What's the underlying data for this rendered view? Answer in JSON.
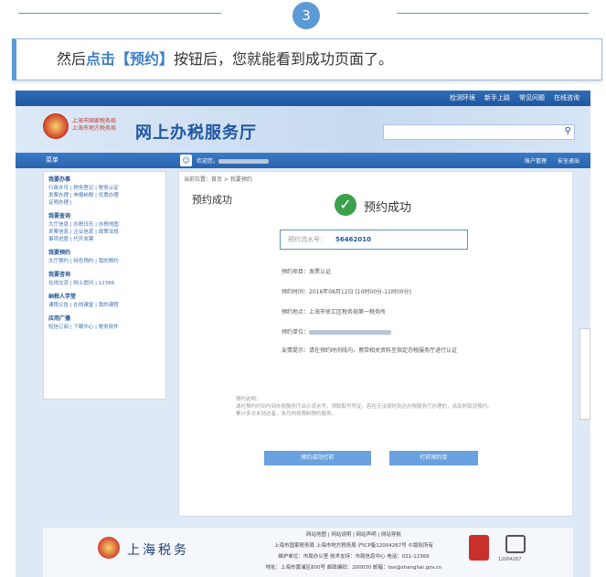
{
  "step": {
    "number": "3",
    "color": "#5b9bd5"
  },
  "instruction": {
    "before": "然后",
    "highlight": "点击【预约】",
    "after": "按钮后，您就能看到成功页面了。"
  },
  "portal": {
    "toplinks": [
      "检测环境",
      "新手上路",
      "常见问题",
      "在线咨询"
    ],
    "org_line1": "上海市国家税务局",
    "org_line2": "上海市地方税务局",
    "site_title": "网上办税服务厅",
    "nav": {
      "menu": "菜单",
      "welcome": "欢迎您，",
      "right": [
        "账户管理",
        "安全退出"
      ]
    },
    "sidebar": [
      {
        "title": "我要办事",
        "links": "行政许可 | 税务登记 | 税务认定\n发票办理 | 申报纳税 | 优惠办理\n证明办理 |"
      },
      {
        "title": "我要查询",
        "links": "大厅信息 | 办税日历 | 办税地图\n发票信息 | 企业信息 | 政策法规\n事项进度 | 代开发票"
      },
      {
        "title": "我要预约",
        "links": "大厅预约 | 特色预约 | 我的预约"
      },
      {
        "title": "我要咨询",
        "links": "在线交流 | 网上提问 | 12366"
      },
      {
        "title": "纳税人学堂",
        "links": "课程公告 | 在线课堂 | 我的课程"
      },
      {
        "title": "应用广播",
        "links": "短信订阅 | 下载中心 | 税务软件"
      }
    ],
    "breadcrumb": "当前位置：首页 > 我要预约",
    "content_heading": "预约成功",
    "success_text": "预约成功",
    "appointment_label": "预约流水号：",
    "appointment_number": "56462010",
    "details": [
      "预约项目：发票认证",
      "预约时间：2016年08月12日 [10时00分-11时00分]",
      "预约地点：上海市徐汇区税务局第一税务所",
      "预约单位：",
      "友情提示：请在预约时间段内，携带相关资料至指定办税服务厅进行认证"
    ],
    "note": "预约说明：\n请在预约时间内到办税服务厅出示流水号，领取取号凭证。若在无法按时到达办税服务厅办理的，请及时取消预约。\n累计多次未到达者，本月内将限制预约服务。",
    "buttons": [
      "预约成功打印",
      "打印预约单"
    ],
    "footer_name": "上海税务",
    "footer_lines": [
      "网站地图 | 网站说明 | 网站声明 | 网站导航",
      "上海市国家税务局 上海市地方税务局 沪ICP备12004267号 ©版权所有",
      "维护单位：市局办公室  技术支持：市局信息中心  电话：021-12366",
      "地址：上海市黄浦区800号  邮政编码：200030  邮箱：tax@shanghai.gov.cn"
    ],
    "badge_label": "12004267"
  }
}
